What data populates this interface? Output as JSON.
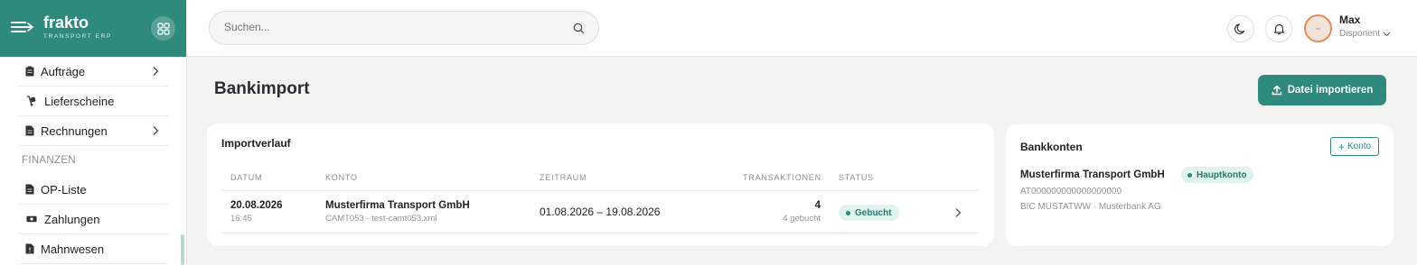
{
  "brand": {
    "name": "frakto",
    "subtitle": "TRANSPORT ERP"
  },
  "sidebar": {
    "items": [
      {
        "label": "Aufträge",
        "has_children": true
      },
      {
        "label": "Lieferscheine",
        "has_children": false
      },
      {
        "label": "Rechnungen",
        "has_children": true
      }
    ],
    "section": "FINANZEN",
    "section_items": [
      {
        "label": "OP-Liste"
      },
      {
        "label": "Zahlungen"
      },
      {
        "label": "Mahnwesen"
      }
    ]
  },
  "header": {
    "search_placeholder": "Suchen...",
    "user": {
      "name": "Max",
      "role": "Disponent"
    }
  },
  "page": {
    "title": "Bankimport",
    "import_button": "Datei importieren"
  },
  "history": {
    "title": "Importverlauf",
    "columns": [
      "DATUM",
      "KONTO",
      "ZEITRAUM",
      "TRANSAKTIONEN",
      "STATUS"
    ],
    "rows": [
      {
        "date": "20.08.2026",
        "time": "16:45",
        "account": "Musterfirma Transport GmbH",
        "file": "CAMT053 · test-camt053.xml",
        "period": "01.08.2026 – 19.08.2026",
        "transactions": "4",
        "booked": "4 gebucht",
        "status": "Gebucht"
      }
    ]
  },
  "accounts": {
    "title": "Bankkonten",
    "add_button": "Konto",
    "items": [
      {
        "name": "Musterfirma Transport GmbH",
        "badge": "Hauptkonto",
        "iban": "AT000000000000000000",
        "bic_bank": "BIC MUSTATWW · Musterbank AG"
      }
    ]
  },
  "colors": {
    "brand": "#2f8a7e",
    "badge_bg": "#e1f2ee",
    "avatar_ring": "#e58d5a"
  }
}
